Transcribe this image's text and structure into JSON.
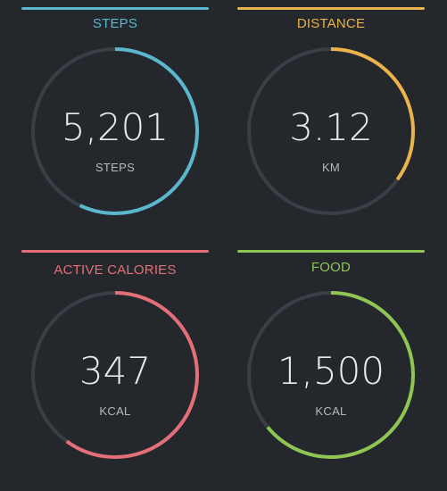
{
  "colors": {
    "background": "#24272c",
    "track": "#3a3e45",
    "value_text": "#e8e9eb",
    "unit_text": "#b6b9be"
  },
  "cards": [
    {
      "id": "steps",
      "title": "STEPS",
      "value": "5,201",
      "unit": "STEPS",
      "color": "#5ab7cd",
      "progress": 0.57,
      "progress_start": "top",
      "progress_direction": "clockwise"
    },
    {
      "id": "distance",
      "title": "DISTANCE",
      "value": "3.12",
      "unit": "KM",
      "color": "#eab34b",
      "progress": 0.35,
      "progress_start": "top",
      "progress_direction": "clockwise"
    },
    {
      "id": "active-calories",
      "title": "ACTIVE CALORIES",
      "value": "347",
      "unit": "KCAL",
      "color": "#e56f78",
      "progress": 0.6,
      "progress_start": "top",
      "progress_direction": "clockwise"
    },
    {
      "id": "food",
      "title": "FOOD",
      "value": "1,500",
      "unit": "KCAL",
      "color": "#8fc653",
      "progress": 0.64,
      "progress_start": "top",
      "progress_direction": "clockwise"
    }
  ]
}
